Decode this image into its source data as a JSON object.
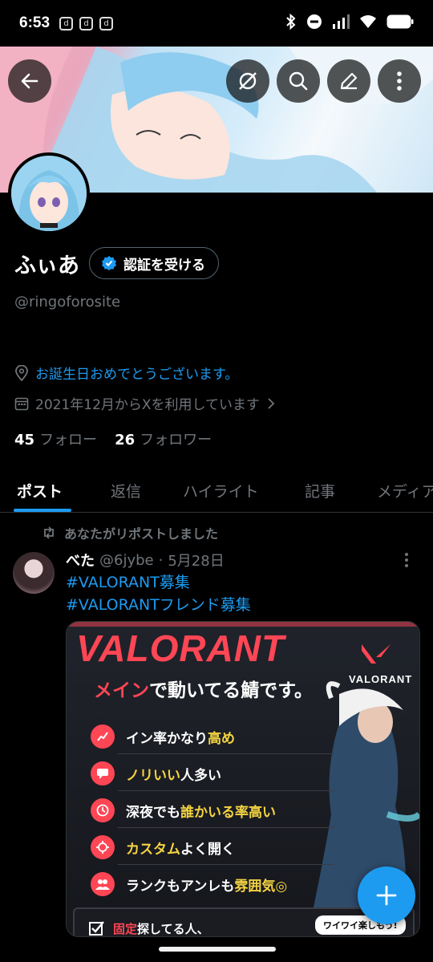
{
  "status_bar": {
    "time": "6:53",
    "app_icons": [
      "d",
      "d",
      "d"
    ]
  },
  "header": {
    "back_icon": "arrow-left-icon",
    "buttons": [
      "disable-icon",
      "search-icon",
      "edit-icon",
      "more-vertical-icon"
    ]
  },
  "profile": {
    "name": "ふぃあ",
    "verify_label": "認証を受ける",
    "handle": "@ringoforosite",
    "birthday": "お誕生日おめでとうございます。",
    "joined": "2021年12月からXを利用しています",
    "following_count": "45",
    "following_label": "フォロー",
    "followers_count": "26",
    "followers_label": "フォロワー"
  },
  "tabs": [
    {
      "label": "ポスト",
      "active": true
    },
    {
      "label": "返信"
    },
    {
      "label": "ハイライト"
    },
    {
      "label": "記事"
    },
    {
      "label": "メディア"
    }
  ],
  "post": {
    "repost_label": "あなたがリポストしました",
    "author_name": "べた",
    "author_handle": "@6jybe",
    "date": "5月28日",
    "separator": "·",
    "hashtags": [
      "#VALORANT募集",
      "#VALORANTフレンド募集"
    ],
    "media": {
      "title": "VALORANT",
      "subtitle_red": "メイン",
      "subtitle_rest": "で動いてる鯖です。",
      "logo_text": "VALORANT",
      "features": [
        {
          "text": "イン率かなり",
          "highlight": "高め",
          "icon": "chart-icon"
        },
        {
          "text_highlight_first": "ノリいい",
          "text": "人多い",
          "icon": "chat-icon"
        },
        {
          "text": "深夜でも",
          "highlight": "誰かいる率高い",
          "icon": "clock-icon"
        },
        {
          "text_highlight_first": "カスタム",
          "text": "よく開く",
          "icon": "target-icon"
        },
        {
          "text": "ランクもアンレも",
          "highlight": "雰囲気◎",
          "icon": "group-icon"
        }
      ],
      "bottom_red": "固定",
      "bottom_text": "探してる人、",
      "bubble": "ワイワイ楽しもう!"
    }
  },
  "colors": {
    "accent": "#1d9bf0",
    "valorant_red": "#ff4655",
    "highlight": "#f5d442"
  }
}
